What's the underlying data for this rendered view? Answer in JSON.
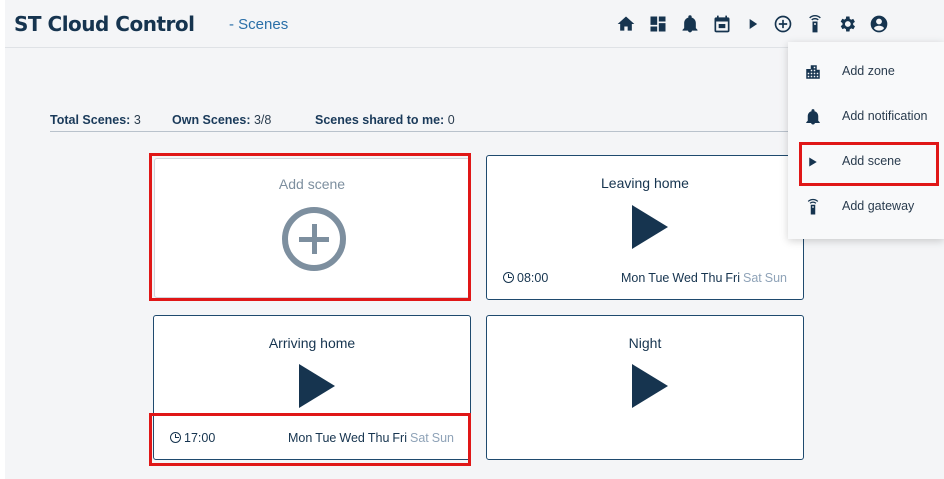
{
  "app": {
    "brand": "ST Cloud Control",
    "section": "- Scenes"
  },
  "toolbar": {
    "icons": [
      "home-icon",
      "dashboard-icon",
      "bell-icon",
      "calendar-icon",
      "play-icon",
      "add-circle-icon",
      "gateway-icon",
      "gear-icon",
      "account-icon"
    ]
  },
  "add_menu": {
    "items": [
      {
        "label": "Add zone",
        "icon": "building-icon"
      },
      {
        "label": "Add notification",
        "icon": "bell-icon"
      },
      {
        "label": "Add scene",
        "icon": "play-icon"
      },
      {
        "label": "Add gateway",
        "icon": "gateway-icon"
      }
    ]
  },
  "stats": {
    "total_label": "Total Scenes:",
    "total_value": "3",
    "own_label": "Own Scenes:",
    "own_value": "3/8",
    "shared_label": "Scenes shared to me:",
    "shared_value": "0"
  },
  "scenes": {
    "add_label": "Add scene",
    "cards": [
      {
        "title": "Leaving home",
        "time": "08:00",
        "days": [
          {
            "d": "Mon",
            "active": true
          },
          {
            "d": "Tue",
            "active": true
          },
          {
            "d": "Wed",
            "active": true
          },
          {
            "d": "Thu",
            "active": true
          },
          {
            "d": "Fri",
            "active": true
          },
          {
            "d": "Sat",
            "active": false
          },
          {
            "d": "Sun",
            "active": false
          }
        ]
      },
      {
        "title": "Arriving home",
        "time": "17:00",
        "days": [
          {
            "d": "Mon",
            "active": true
          },
          {
            "d": "Tue",
            "active": true
          },
          {
            "d": "Wed",
            "active": true
          },
          {
            "d": "Thu",
            "active": true
          },
          {
            "d": "Fri",
            "active": true
          },
          {
            "d": "Sat",
            "active": false
          },
          {
            "d": "Sun",
            "active": false
          }
        ]
      },
      {
        "title": "Night"
      }
    ]
  },
  "colors": {
    "primary": "#16344f",
    "accent": "#2a6fa8",
    "highlight": "#e01717",
    "muted_day": "#8fa3b8"
  }
}
